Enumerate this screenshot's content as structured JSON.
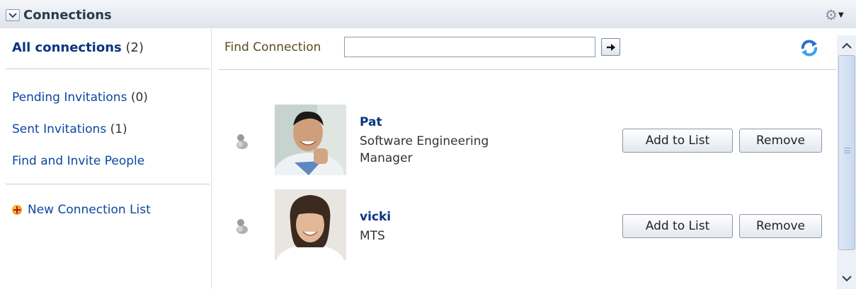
{
  "header": {
    "title": "Connections",
    "collapse_icon": "chevron-down-icon",
    "settings_icon": "gear-icon"
  },
  "sidebar": {
    "all": {
      "label": "All connections",
      "count": "(2)"
    },
    "links": [
      {
        "label": "Pending Invitations",
        "count": "(0)"
      },
      {
        "label": "Sent Invitations",
        "count": "(1)"
      },
      {
        "label": "Find and Invite People",
        "count": ""
      }
    ],
    "new_list": {
      "label": "New Connection List",
      "icon": "plus-icon"
    }
  },
  "search": {
    "label": "Find Connection",
    "value": "",
    "placeholder": "",
    "go_icon": "arrow-right-icon"
  },
  "refresh_icon": "refresh-icon",
  "connections": [
    {
      "name": "Pat",
      "title_line1": "Software Engineering",
      "title_line2": "Manager",
      "add_label": "Add to List",
      "remove_label": "Remove"
    },
    {
      "name": "vicki",
      "title_line1": "MTS",
      "title_line2": "",
      "add_label": "Add to List",
      "remove_label": "Remove"
    }
  ],
  "colors": {
    "link": "#0b47a0",
    "name": "#0a3582",
    "header_bg": "#dfe4ec",
    "scroll_thumb": "#c9d8ef"
  }
}
